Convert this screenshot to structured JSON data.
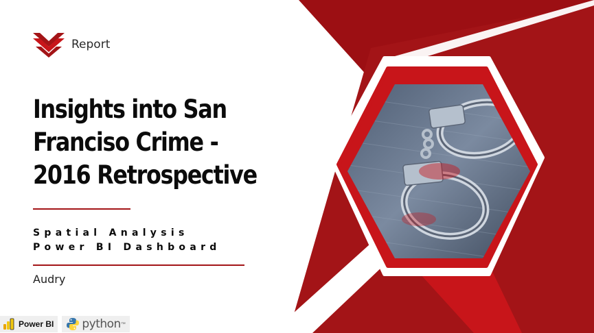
{
  "brand": {
    "label": "Report",
    "logo_icon": "chevron-stack-logo",
    "color": "#a31417"
  },
  "title": {
    "line1": "Insights into San",
    "line2": "Franciso Crime -",
    "line3": "2016 Retrospective"
  },
  "subtitle": {
    "line1": "Spatial Analysis",
    "line2": "Power BI Dashboard"
  },
  "author": "Audry",
  "badges": {
    "powerbi": {
      "label": "Power BI",
      "icon": "powerbi-icon"
    },
    "python": {
      "label": "python",
      "mark": "™",
      "icon": "python-icon"
    }
  },
  "hero_image": {
    "subject": "handcuffs",
    "icon": "handcuffs-photo"
  },
  "colors": {
    "primary": "#a31417",
    "bright_red": "#c8151a",
    "dark_red": "#8a0c10",
    "text": "#0b0b0b"
  }
}
